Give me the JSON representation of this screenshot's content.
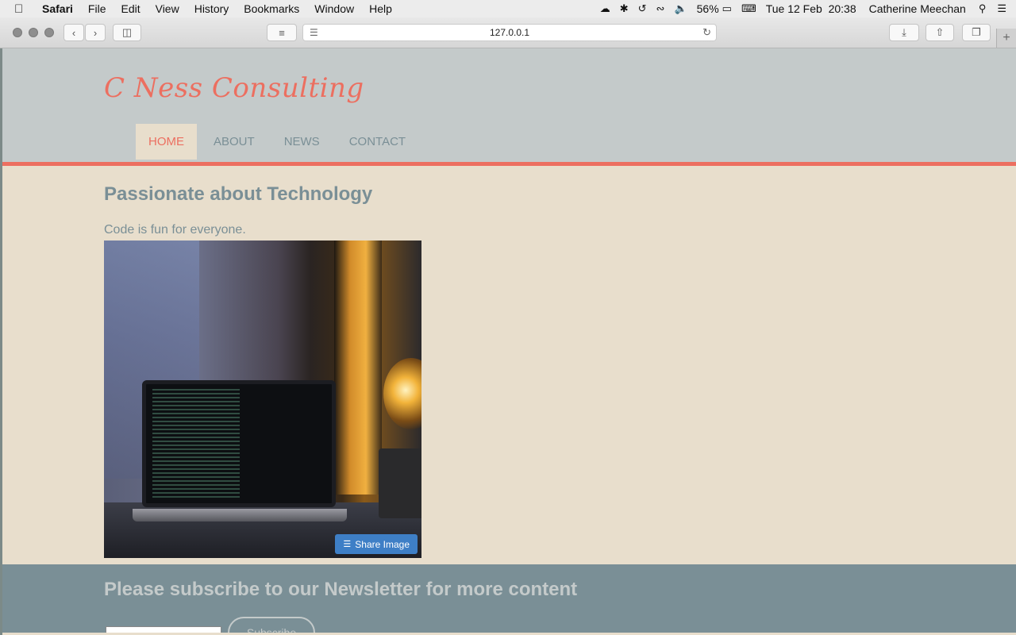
{
  "menubar": {
    "app": "Safari",
    "items": [
      "File",
      "Edit",
      "View",
      "History",
      "Bookmarks",
      "Window",
      "Help"
    ],
    "battery": "56%",
    "datetime": "Tue 12 Feb  20:38",
    "user": "Catherine Meechan"
  },
  "browser": {
    "url": "127.0.0.1"
  },
  "site": {
    "brand": "C Ness Consulting",
    "nav": [
      "HOME",
      "ABOUT",
      "NEWS",
      "CONTACT"
    ],
    "active_nav": "HOME",
    "headline": "Passionate about Technology",
    "tagline": "Code is fun for everyone.",
    "share_label": "Share Image",
    "newsletter_title": "Please subscribe to our Newsletter for more content",
    "subscribe_label": "Subscribe"
  },
  "colors": {
    "accent": "#ec6f60",
    "header_bg": "#c4caca",
    "page_bg": "#e8decc",
    "slate": "#7a8f96",
    "share_blue": "#3e7fc6"
  }
}
